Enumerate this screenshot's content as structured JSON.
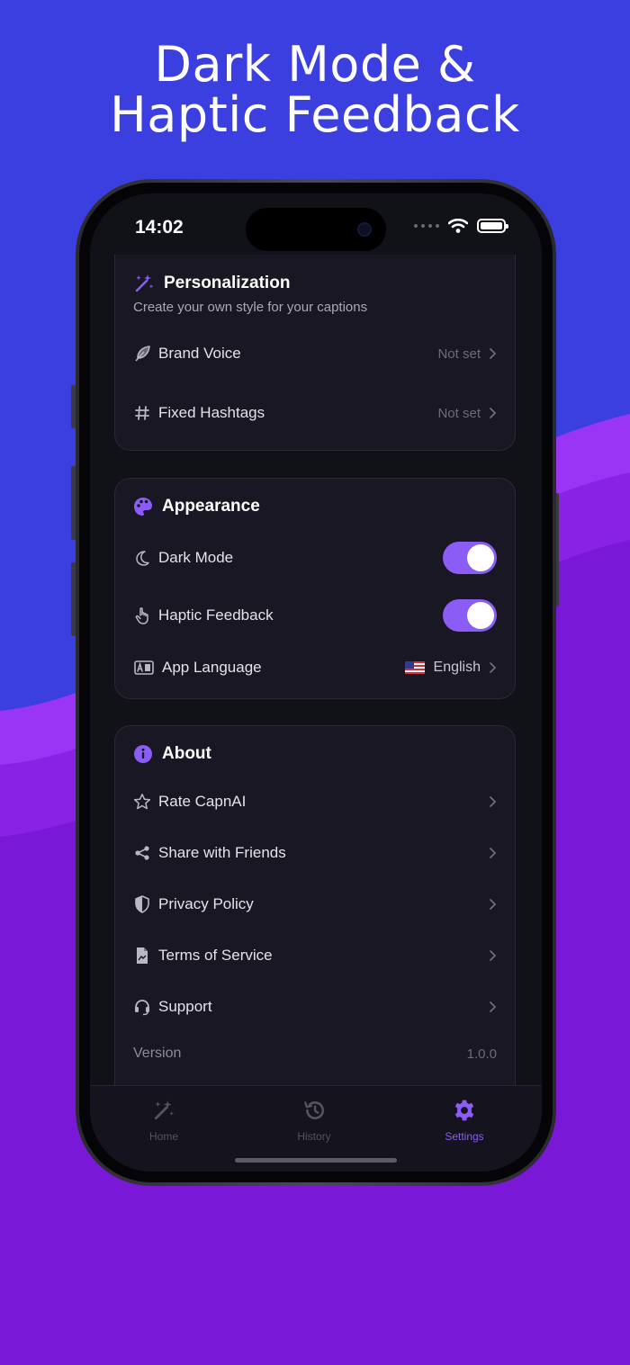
{
  "headline": {
    "line1": "Dark Mode &",
    "line2": "Haptic Feedback"
  },
  "status_bar": {
    "time": "14:02"
  },
  "personalization": {
    "title": "Personalization",
    "subtitle": "Create your own style for your captions",
    "icon": "magic-wand-icon",
    "rows": [
      {
        "label": "Brand Voice",
        "value": "Not set",
        "icon": "feather-icon"
      },
      {
        "label": "Fixed Hashtags",
        "value": "Not set",
        "icon": "hashtag-icon"
      }
    ]
  },
  "appearance": {
    "title": "Appearance",
    "icon": "palette-icon",
    "rows": [
      {
        "label": "Dark Mode",
        "icon": "moon-icon",
        "enabled": true
      },
      {
        "label": "Haptic Feedback",
        "icon": "hand-tap-icon",
        "enabled": true
      },
      {
        "label": "App Language",
        "icon": "language-icon",
        "value": "English",
        "flag": "us-flag-icon"
      }
    ]
  },
  "about": {
    "title": "About",
    "icon": "info-icon",
    "rows": [
      {
        "label": "Rate CapnAI",
        "icon": "star-icon"
      },
      {
        "label": "Share with Friends",
        "icon": "share-icon"
      },
      {
        "label": "Privacy Policy",
        "icon": "shield-icon"
      },
      {
        "label": "Terms of Service",
        "icon": "document-icon"
      },
      {
        "label": "Support",
        "icon": "headset-icon"
      }
    ],
    "version_label": "Version",
    "version_value": "1.0.0"
  },
  "tabs": [
    {
      "label": "Home",
      "icon": "magic-wand-icon",
      "active": false
    },
    {
      "label": "History",
      "icon": "history-icon",
      "active": false
    },
    {
      "label": "Settings",
      "icon": "gear-icon",
      "active": true
    }
  ],
  "colors": {
    "background_blue": "#3b3fe0",
    "background_purple": "#7a18d8",
    "accent": "#8b5cf6",
    "card": "#1a1724",
    "screen": "#111118"
  }
}
